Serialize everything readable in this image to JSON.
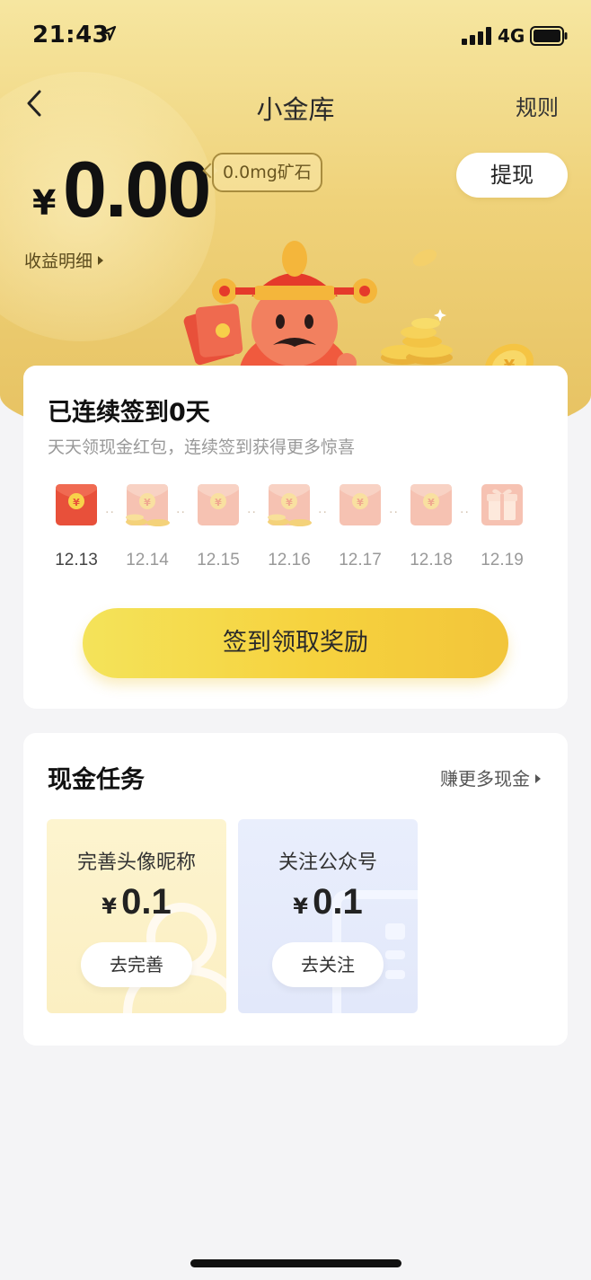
{
  "status_bar": {
    "time": "21:43",
    "network": "4G"
  },
  "nav": {
    "title": "小金库",
    "rules_label": "规则"
  },
  "balance": {
    "currency": "¥",
    "amount": "0.00",
    "ore": "0.0mg矿石",
    "withdraw_label": "提现",
    "earnings_link": "收益明细"
  },
  "signin": {
    "title": "已连续签到0天",
    "subtitle": "天天领现金红包，连续签到获得更多惊喜",
    "days": [
      "12.13",
      "12.14",
      "12.15",
      "12.16",
      "12.17",
      "12.18",
      "12.19"
    ],
    "days_icons": [
      "red-envelope-icon-active",
      "red-envelope-coins-icon",
      "red-envelope-icon",
      "red-envelope-coins-icon",
      "red-envelope-icon",
      "red-envelope-icon",
      "gift-box-icon"
    ],
    "button_label": "签到领取奖励"
  },
  "tasks": {
    "title": "现金任务",
    "earn_more": "赚更多现金",
    "items": [
      {
        "name": "完善头像昵称",
        "currency": "¥",
        "amount": "0.1",
        "button": "去完善"
      },
      {
        "name": "关注公众号",
        "currency": "¥",
        "amount": "0.1",
        "button": "去关注"
      }
    ]
  },
  "colors": {
    "hero_gold": "#efd27a",
    "button_yellow": "#f6d23e",
    "envelope_red": "#e8503a",
    "envelope_pink": "#f6c2b2"
  }
}
